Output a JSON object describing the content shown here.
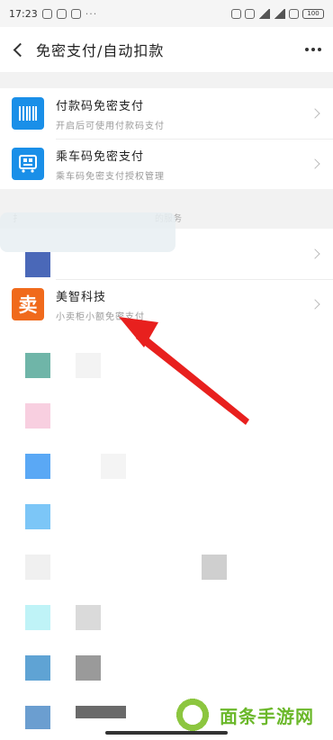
{
  "status_bar": {
    "time": "17:23",
    "dots": "···",
    "battery": "100"
  },
  "nav": {
    "title": "免密支付/自动扣款"
  },
  "payment_section": {
    "items": [
      {
        "title": "付款码免密支付",
        "subtitle": "开启后可使用付款码支付",
        "icon": "barcode-icon"
      },
      {
        "title": "乘车码免密支付",
        "subtitle": "乘车码免密支付授权管理",
        "icon": "bus-qr-icon"
      }
    ]
  },
  "services_section": {
    "label_left": "扌",
    "label_right": "的服务",
    "featured": {
      "title": "美智科技",
      "subtitle": "小卖柜小额免密支付",
      "icon_char": "卖",
      "icon_color": "#f06a1c"
    }
  },
  "watermark": {
    "text": "面条手游网"
  },
  "colors": {
    "accent_blue": "#1a8fe8",
    "arrow_red": "#e8201e",
    "watermark_green": "#8cc63f"
  }
}
